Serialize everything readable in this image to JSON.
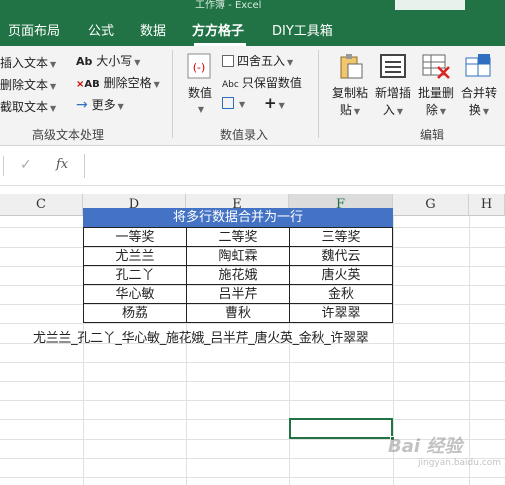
{
  "window": {
    "title": "工作簿 - Excel"
  },
  "tabs": [
    {
      "label": "页面布局",
      "active": false
    },
    {
      "label": "公式",
      "active": false
    },
    {
      "label": "数据",
      "active": false
    },
    {
      "label": "方方格子",
      "active": true
    },
    {
      "label": "DIY工具箱",
      "active": false
    }
  ],
  "ribbon": {
    "text_group": {
      "label": "高级文本处理",
      "items": [
        "插入文本",
        "删除文本",
        "截取文本"
      ],
      "right_items": [
        "大小写",
        "删除空格",
        "更多"
      ]
    },
    "number_group": {
      "label": "数值录入",
      "big_button": "数值",
      "items": [
        "四舍五入",
        "只保留数值"
      ]
    },
    "edit_group": {
      "label": "编辑",
      "buttons": [
        {
          "line1": "复制粘",
          "line2": "贴"
        },
        {
          "line1": "新增插",
          "line2": "入"
        },
        {
          "line1": "批量删",
          "line2": "除"
        },
        {
          "line1": "合并转",
          "line2": "换"
        }
      ]
    }
  },
  "formula_bar": {
    "fx_label": "fx",
    "value": ""
  },
  "columns": [
    "C",
    "D",
    "E",
    "F",
    "G",
    "H"
  ],
  "sheet": {
    "merged_title": "将多行数据合并为一行",
    "table": [
      [
        "一等奖",
        "二等奖",
        "三等奖"
      ],
      [
        "尤兰兰",
        "陶虹霖",
        "魏代云"
      ],
      [
        "孔二丫",
        "施花娥",
        "唐火英"
      ],
      [
        "华心敏",
        "吕半芹",
        "金秋"
      ],
      [
        "杨荔",
        "曹秋",
        "许翠翠"
      ]
    ],
    "merged_row": "尤兰兰_孔二丫_华心敏_施花娥_吕半芹_唐火英_金秋_许翠翠"
  },
  "watermark": {
    "text": "Bai 经验",
    "sub": "jingyan.baidu.com"
  }
}
